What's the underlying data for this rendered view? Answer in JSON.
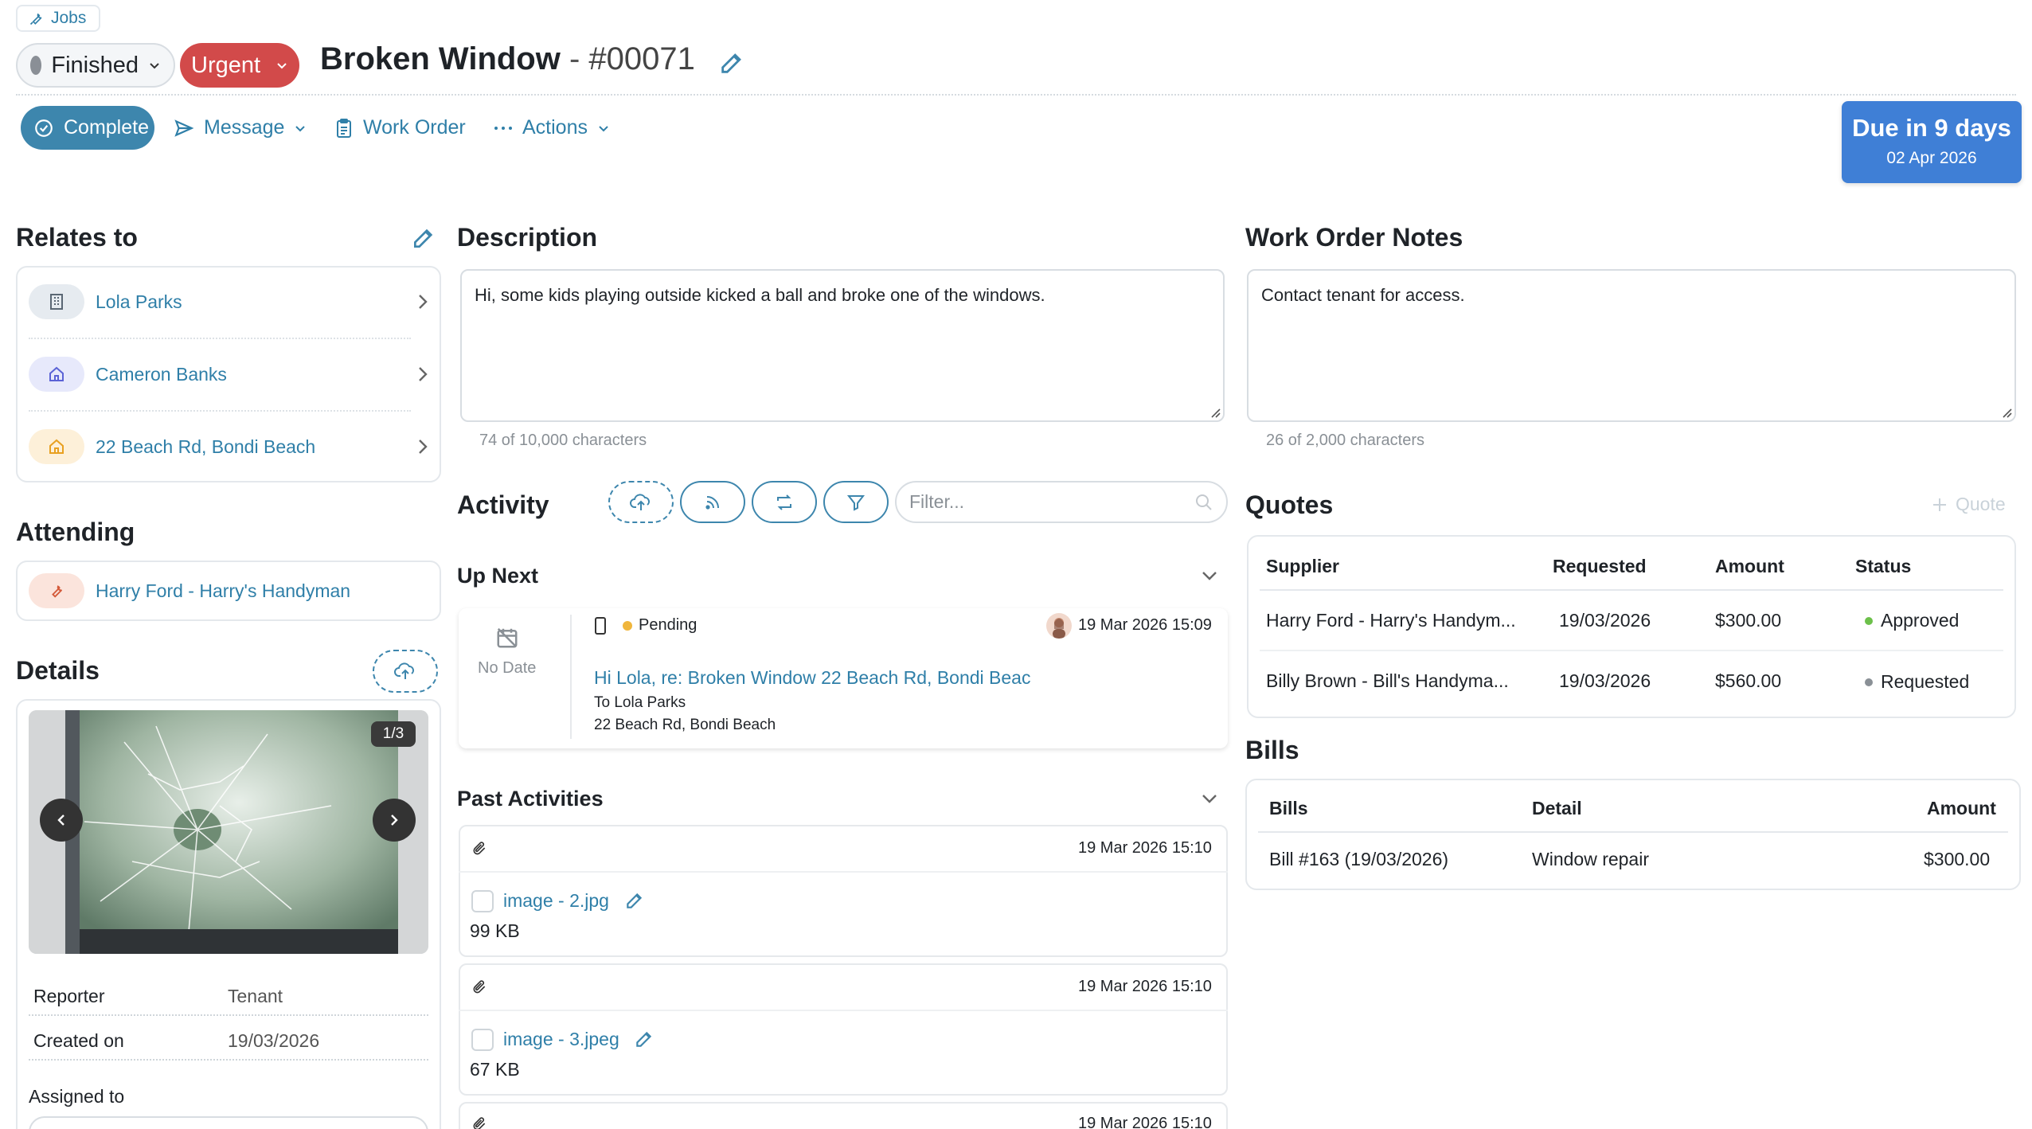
{
  "header": {
    "jobs_tag": "Jobs",
    "status": "Finished",
    "priority": "Urgent",
    "title": "Broken Window",
    "title_separator": " - ",
    "job_number": "#00071"
  },
  "toolbar": {
    "complete": "Complete",
    "message": "Message",
    "work_order": "Work Order",
    "actions": "Actions"
  },
  "due": {
    "label": "Due in 9 days",
    "date": "02 Apr 2026"
  },
  "relates": {
    "title": "Relates to",
    "items": [
      {
        "label": "Lola Parks",
        "icon": "building-icon"
      },
      {
        "label": "Cameron Banks",
        "icon": "house-icon"
      },
      {
        "label": "22 Beach Rd, Bondi Beach",
        "icon": "home-icon"
      }
    ]
  },
  "attending": {
    "title": "Attending",
    "name": "Harry Ford - Harry's Handyman"
  },
  "details": {
    "title": "Details",
    "photo_counter": "1/3",
    "reporter_label": "Reporter",
    "reporter_value": "Tenant",
    "created_label": "Created on",
    "created_value": "19/03/2026",
    "assigned_label": "Assigned to"
  },
  "description": {
    "title": "Description",
    "text": "Hi, some kids playing outside kicked a ball and broke one of the windows.",
    "counter": "74 of 10,000 characters"
  },
  "work_order_notes": {
    "title": "Work Order Notes",
    "text": "Contact tenant for access.",
    "counter": "26 of 2,000 characters"
  },
  "activity": {
    "title": "Activity",
    "filter_placeholder": "Filter...",
    "up_next_title": "Up Next",
    "up_next": {
      "no_date": "No Date",
      "status": "Pending",
      "timestamp": "19 Mar 2026 15:09",
      "subject": "Hi Lola, re: Broken Window 22 Beach Rd, Bondi Beac",
      "to": "To Lola Parks",
      "address": "22 Beach Rd, Bondi Beach"
    },
    "past_title": "Past Activities",
    "past": [
      {
        "timestamp": "19 Mar 2026 15:10",
        "file": "image - 2.jpg",
        "size": "99 KB"
      },
      {
        "timestamp": "19 Mar 2026 15:10",
        "file": "image - 3.jpeg",
        "size": "67 KB"
      },
      {
        "timestamp": "19 Mar 2026 15:10"
      }
    ]
  },
  "quotes": {
    "title": "Quotes",
    "add_label": "Quote",
    "columns": [
      "Supplier",
      "Requested",
      "Amount",
      "Status"
    ],
    "rows": [
      {
        "supplier": "Harry Ford - Harry's Handym...",
        "requested": "19/03/2026",
        "amount": "$300.00",
        "status": "Approved",
        "status_color": "#6cc04a"
      },
      {
        "supplier": "Billy Brown - Bill's Handyma...",
        "requested": "19/03/2026",
        "amount": "$560.00",
        "status": "Requested",
        "status_color": "#8a9096"
      }
    ]
  },
  "bills": {
    "title": "Bills",
    "columns": [
      "Bills",
      "Detail",
      "Amount"
    ],
    "rows": [
      {
        "bill": "Bill #163 (19/03/2026)",
        "detail": "Window repair",
        "amount": "$300.00"
      }
    ]
  },
  "colors": {
    "accent": "#3d86ad",
    "link": "#2f7fa8",
    "urgent": "#d24a4a",
    "due": "#3f7fd6"
  }
}
